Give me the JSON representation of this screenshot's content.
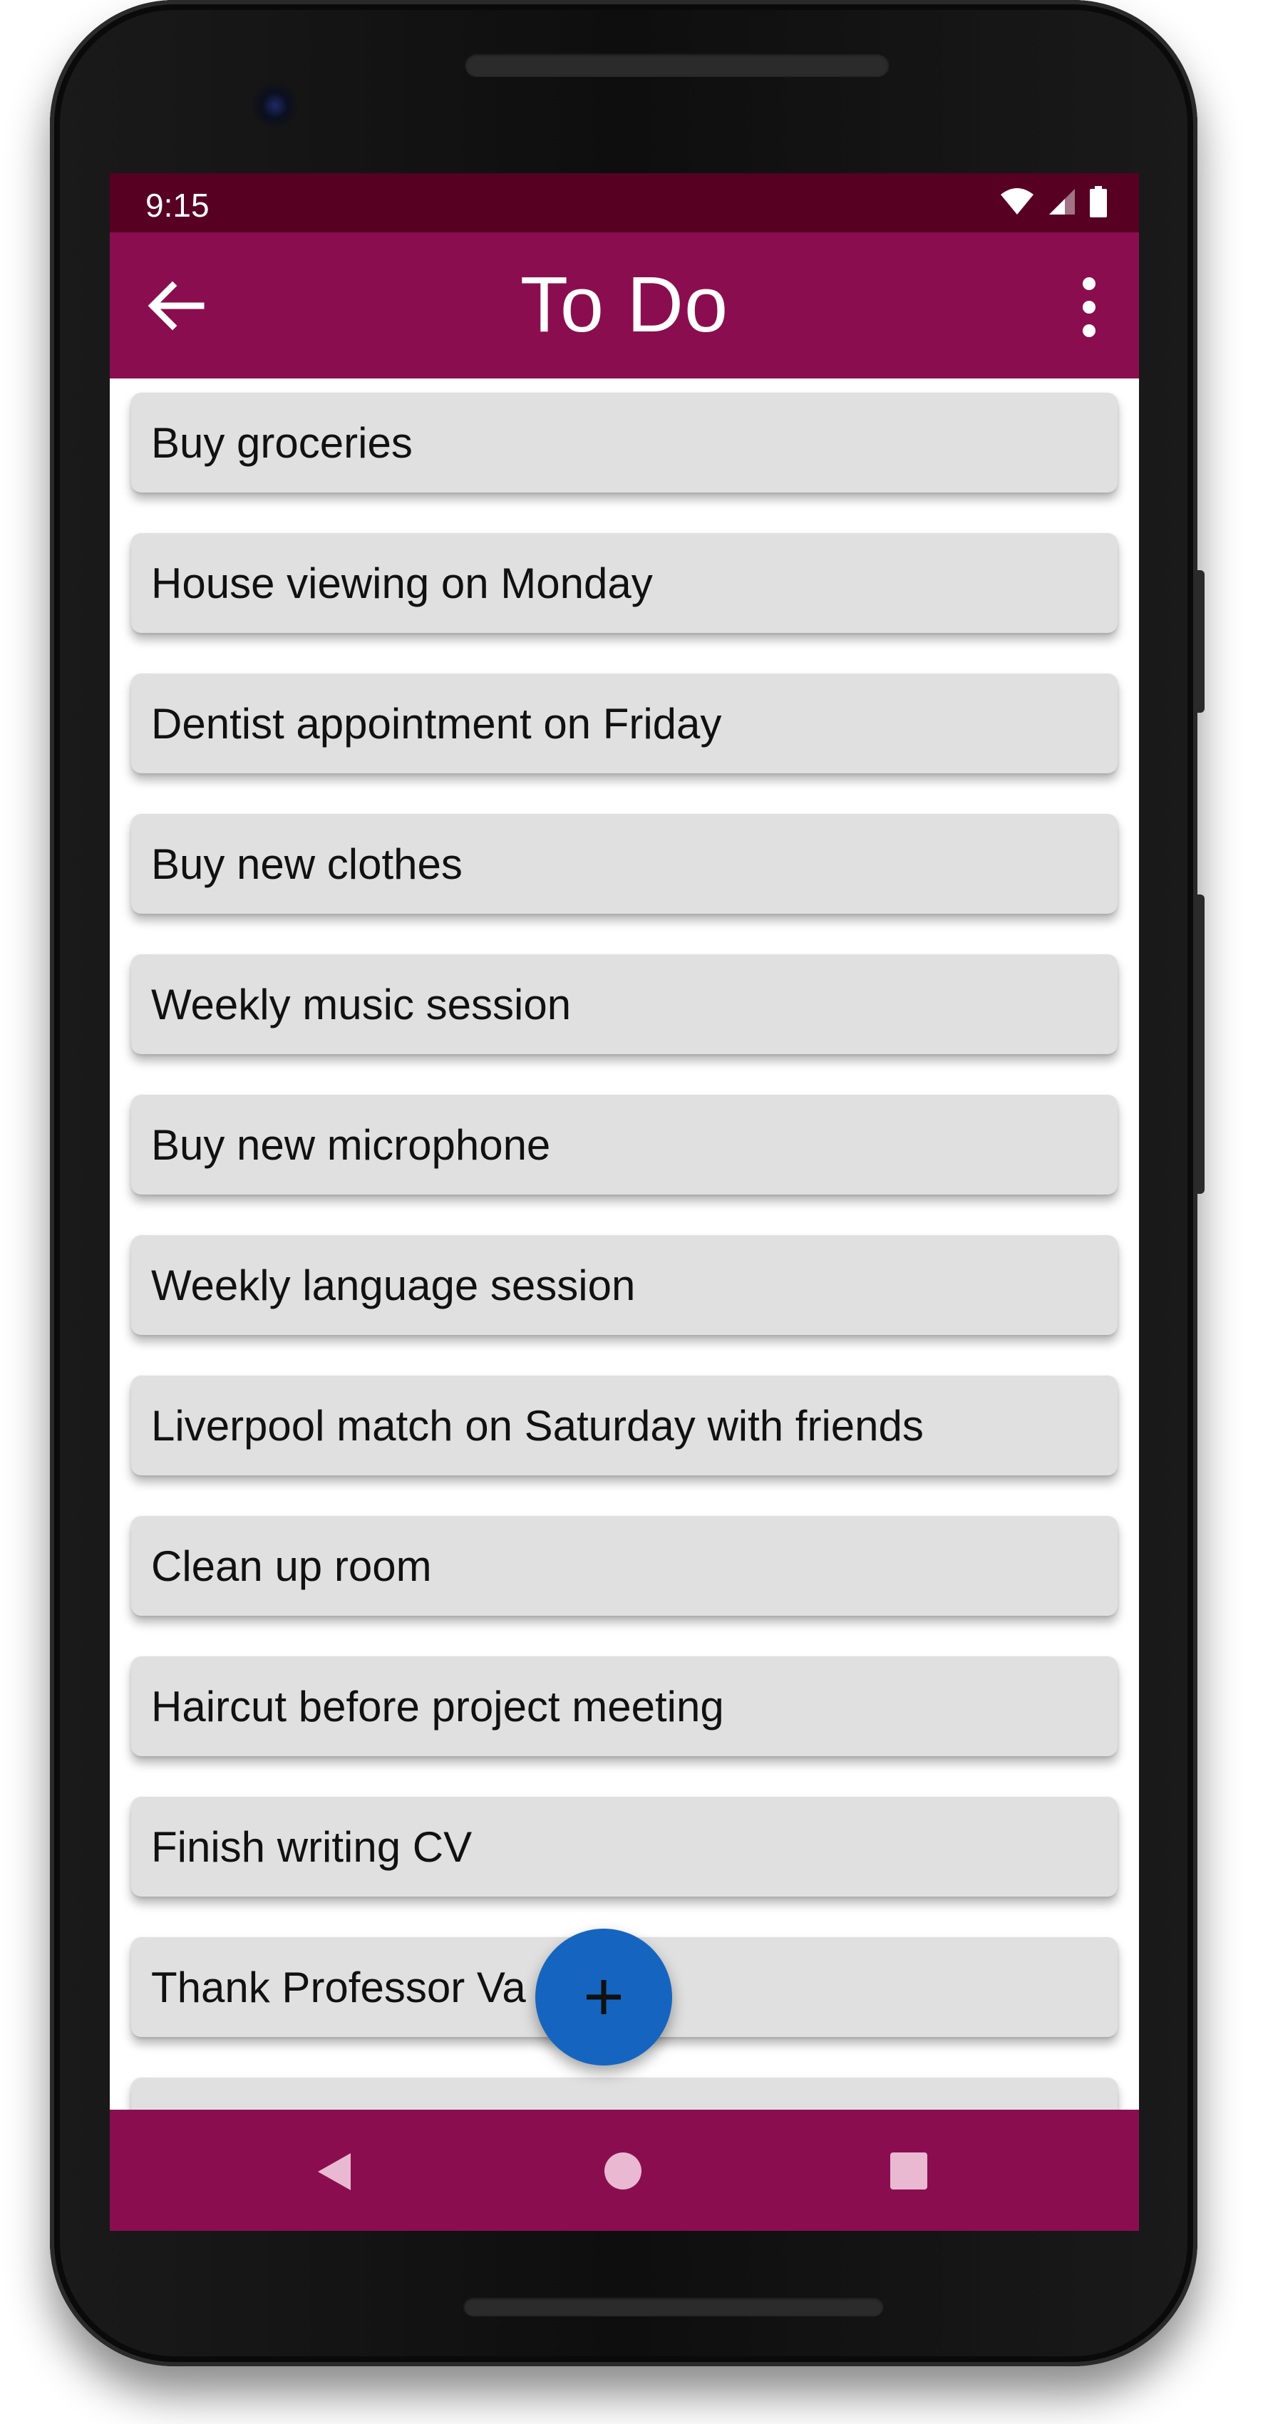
{
  "status_bar": {
    "time": "9:15"
  },
  "app_bar": {
    "title": "To Do"
  },
  "todo_items": [
    "Buy groceries",
    "House viewing on Monday",
    "Dentist appointment on Friday",
    "Buy new clothes",
    "Weekly music session",
    "Buy new microphone",
    "Weekly language session",
    "Liverpool match on Saturday with friends",
    "Clean up room",
    "Haircut before project meeting",
    "Finish writing CV",
    "Thank Professor Va"
  ],
  "fab": {
    "icon": "plus-icon"
  },
  "colors": {
    "status_bar": "#570022",
    "primary": "#8a0e4f",
    "fab": "#1565c0",
    "card": "#e0e0e0"
  }
}
